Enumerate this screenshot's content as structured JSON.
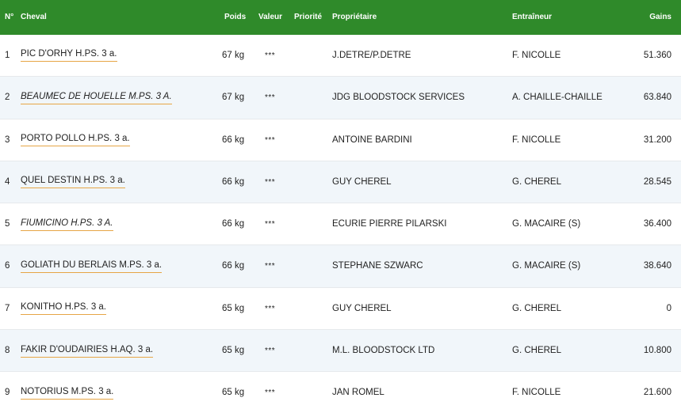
{
  "header": {
    "num": "N°",
    "horse": "Cheval",
    "weight": "Poids",
    "value": "Valeur",
    "priority": "Priorité",
    "owner": "Propriétaire",
    "trainer": "Entraîneur",
    "gains": "Gains"
  },
  "colors": {
    "header_bg": "#2f8a2a",
    "link_underline": "#e6a545",
    "alt_row": "#f1f6fa"
  },
  "rows": [
    {
      "num": "1",
      "horse": "PIC D'ORHY H.PS. 3 a.",
      "italic": false,
      "weight": "67 kg",
      "value": "***",
      "priority": "",
      "owner": "J.DETRE/P.DETRE",
      "trainer": "F. NICOLLE",
      "gains": "51.360"
    },
    {
      "num": "2",
      "horse": "BEAUMEC DE HOUELLE M.PS. 3 A.",
      "italic": true,
      "weight": "67 kg",
      "value": "***",
      "priority": "",
      "owner": "JDG BLOODSTOCK SERVICES",
      "trainer": "A. CHAILLE-CHAILLE",
      "gains": "63.840"
    },
    {
      "num": "3",
      "horse": "PORTO POLLO H.PS. 3 a.",
      "italic": false,
      "weight": "66 kg",
      "value": "***",
      "priority": "",
      "owner": "ANTOINE BARDINI",
      "trainer": "F. NICOLLE",
      "gains": "31.200"
    },
    {
      "num": "4",
      "horse": "QUEL DESTIN H.PS. 3 a.",
      "italic": false,
      "weight": "66 kg",
      "value": "***",
      "priority": "",
      "owner": "GUY CHEREL",
      "trainer": "G. CHEREL",
      "gains": "28.545"
    },
    {
      "num": "5",
      "horse": "FIUMICINO H.PS. 3 A.",
      "italic": true,
      "weight": "66 kg",
      "value": "***",
      "priority": "",
      "owner": "ECURIE PIERRE PILARSKI",
      "trainer": "G. MACAIRE (S)",
      "gains": "36.400"
    },
    {
      "num": "6",
      "horse": "GOLIATH DU BERLAIS M.PS. 3 a.",
      "italic": false,
      "weight": "66 kg",
      "value": "***",
      "priority": "",
      "owner": "STEPHANE SZWARC",
      "trainer": "G. MACAIRE (S)",
      "gains": "38.640"
    },
    {
      "num": "7",
      "horse": "KONITHO H.PS. 3 a.",
      "italic": false,
      "weight": "65 kg",
      "value": "***",
      "priority": "",
      "owner": "GUY CHEREL",
      "trainer": "G. CHEREL",
      "gains": "0"
    },
    {
      "num": "8",
      "horse": "FAKIR D'OUDAIRIES H.AQ. 3 a.",
      "italic": false,
      "weight": "65 kg",
      "value": "***",
      "priority": "",
      "owner": "M.L. BLOODSTOCK LTD",
      "trainer": "G. CHEREL",
      "gains": "10.800"
    },
    {
      "num": "9",
      "horse": "NOTORIUS M.PS. 3 a.",
      "italic": false,
      "weight": "65 kg",
      "value": "***",
      "priority": "",
      "owner": "JAN ROMEL",
      "trainer": "F. NICOLLE",
      "gains": "21.600"
    }
  ]
}
